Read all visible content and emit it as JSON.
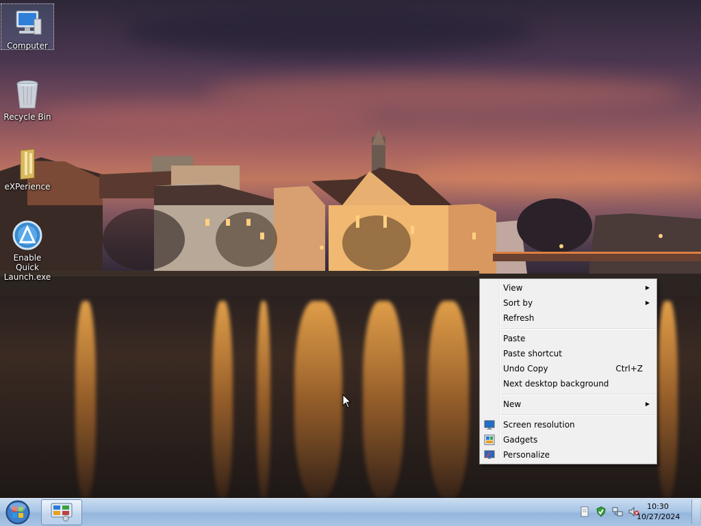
{
  "desktop": {
    "icons": [
      {
        "label": "Computer",
        "icon": "computer-icon",
        "selected": true
      },
      {
        "label": "Recycle Bin",
        "icon": "recycle-bin-icon"
      },
      {
        "label": "eXPerience",
        "icon": "folder-icon"
      },
      {
        "label_line1": "Enable Quick",
        "label_line2": "Launch.exe",
        "icon": "app-icon"
      }
    ]
  },
  "context_menu": {
    "items": [
      {
        "label": "View",
        "submenu": true
      },
      {
        "label": "Sort by",
        "submenu": true
      },
      {
        "label": "Refresh"
      },
      {
        "label": "Paste"
      },
      {
        "label": "Paste shortcut"
      },
      {
        "label": "Undo Copy",
        "shortcut": "Ctrl+Z"
      },
      {
        "label": "Next desktop background"
      },
      {
        "label": "New",
        "submenu": true
      },
      {
        "label": "Screen resolution",
        "icon": "screen-resolution-icon"
      },
      {
        "label": "Gadgets",
        "icon": "gadgets-icon"
      },
      {
        "label": "Personalize",
        "icon": "personalize-icon"
      }
    ]
  },
  "taskbar": {
    "start": "start-orb-icon",
    "pinned": [
      "control-panel-icon"
    ],
    "tray_icons": [
      "action-center-icon",
      "security-icon",
      "network-icon",
      "volume-muted-icon"
    ],
    "clock": {
      "time": "10:30",
      "date": "10/27/2024"
    }
  },
  "colors": {
    "taskbar": "#a9c6e6",
    "menu_bg": "#f0f0f0",
    "menu_border": "#979797"
  }
}
